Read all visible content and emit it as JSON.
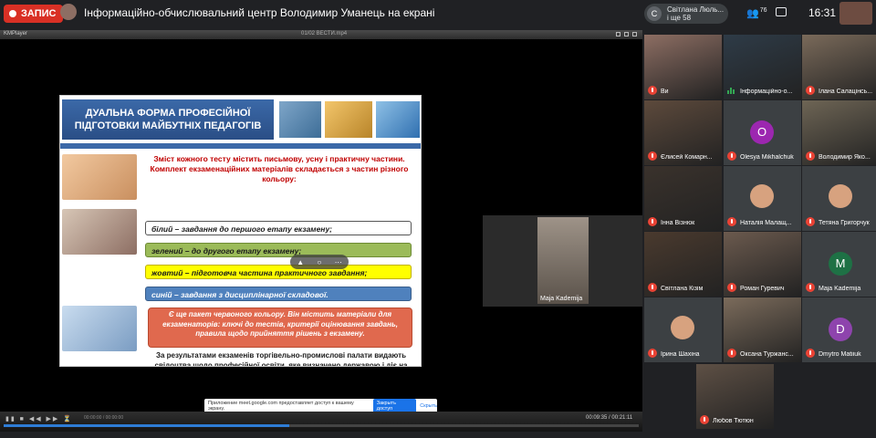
{
  "topbar": {
    "rec_label": "ЗАПИС",
    "meeting_title": "Інформаційно-обчислювальний центр Володимир Уманець на екрані",
    "chip_avatar_letter": "С",
    "chip_line1": "Світлана Люль...",
    "chip_line2": "і ще 58",
    "people_count": "76",
    "clock": "16:31"
  },
  "player": {
    "title_left": "KMPlayer",
    "title_mid": "01/02 ВЕСТИ.mp4",
    "time_left": "00:00:00 / 00:00:00",
    "time_right": "00:09:35 / 00:21:11",
    "progress": 0.45
  },
  "slide": {
    "title": "ДУАЛЬНА ФОРМА ПРОФЕСІЙНОЇ ПІДГОТОВКИ МАЙБУТНІХ ПЕДАГОГІВ",
    "intro": "Зміст кожного тесту містить письмову, усну і практичну частини. Комплект екзаменаційних матеріалів складається з частин різного кольору:",
    "bar_white": "білий – завдання до першого етапу екзамену;",
    "bar_green": "зелений – до другого етапу екзамену;",
    "bar_yellow": "жовтий – підготовча частина практичного завдання;",
    "bar_blue": "синій – завдання з дисциплінарної складової.",
    "red_box": "Є ще пакет червоного кольору. Він містить матеріали для екзаменаторів: ключі до тестів, критерії оцінювання завдань, правила щодо прийняття рішень з екзамену.",
    "footer": "За результатами екзаменів торгівельно-промислові палати видають свідоцтва щодо професійної освіти, яке визначено державою і діє на усій території Німеччини."
  },
  "speaker": {
    "name": "Maja Kademija"
  },
  "toast": {
    "text": "Приложение meet.google.com предоставляет доступ к вашему экрану.",
    "button": "Закрыть доступ",
    "link": "Скрыть"
  },
  "participants": [
    {
      "name": "Ви",
      "type": "video",
      "color": "#8d6e63"
    },
    {
      "name": "Інформаційно-о...",
      "type": "video",
      "color": "#2e3b47",
      "speaking": true
    },
    {
      "name": "Ілана Салацінсь...",
      "type": "video",
      "color": "#7a6a5a"
    },
    {
      "name": "Єлисей Комарн...",
      "type": "video",
      "color": "#5d4a3c"
    },
    {
      "name": "Olesya Mikhalchuk",
      "type": "letter",
      "letter": "O",
      "color": "#9c27b0"
    },
    {
      "name": "Володимир Яко...",
      "type": "video",
      "color": "#6e6555"
    },
    {
      "name": "Інна Візнюк",
      "type": "video",
      "color": "#3a322c"
    },
    {
      "name": "Наталія Малащ...",
      "type": "face",
      "color": "#3c4043"
    },
    {
      "name": "Тетяна Григорчук",
      "type": "face",
      "color": "#3c4043"
    },
    {
      "name": "Світлана Кізім",
      "type": "video",
      "color": "#4a3a2e"
    },
    {
      "name": "Роман Гуревич",
      "type": "video",
      "color": "#6b5a4e"
    },
    {
      "name": "Maja Kademija",
      "type": "letter",
      "letter": "M",
      "color": "#1e7145"
    },
    {
      "name": "Ірина Шахіна",
      "type": "face",
      "color": "#3c4043"
    },
    {
      "name": "Оксана Туржанс...",
      "type": "video",
      "color": "#7b6b5b"
    },
    {
      "name": "Dmytro Matiiuk",
      "type": "letter",
      "letter": "D",
      "color": "#8e44ad"
    },
    {
      "name": "Любов Тютюн",
      "type": "video",
      "color": "#5e5045"
    }
  ]
}
